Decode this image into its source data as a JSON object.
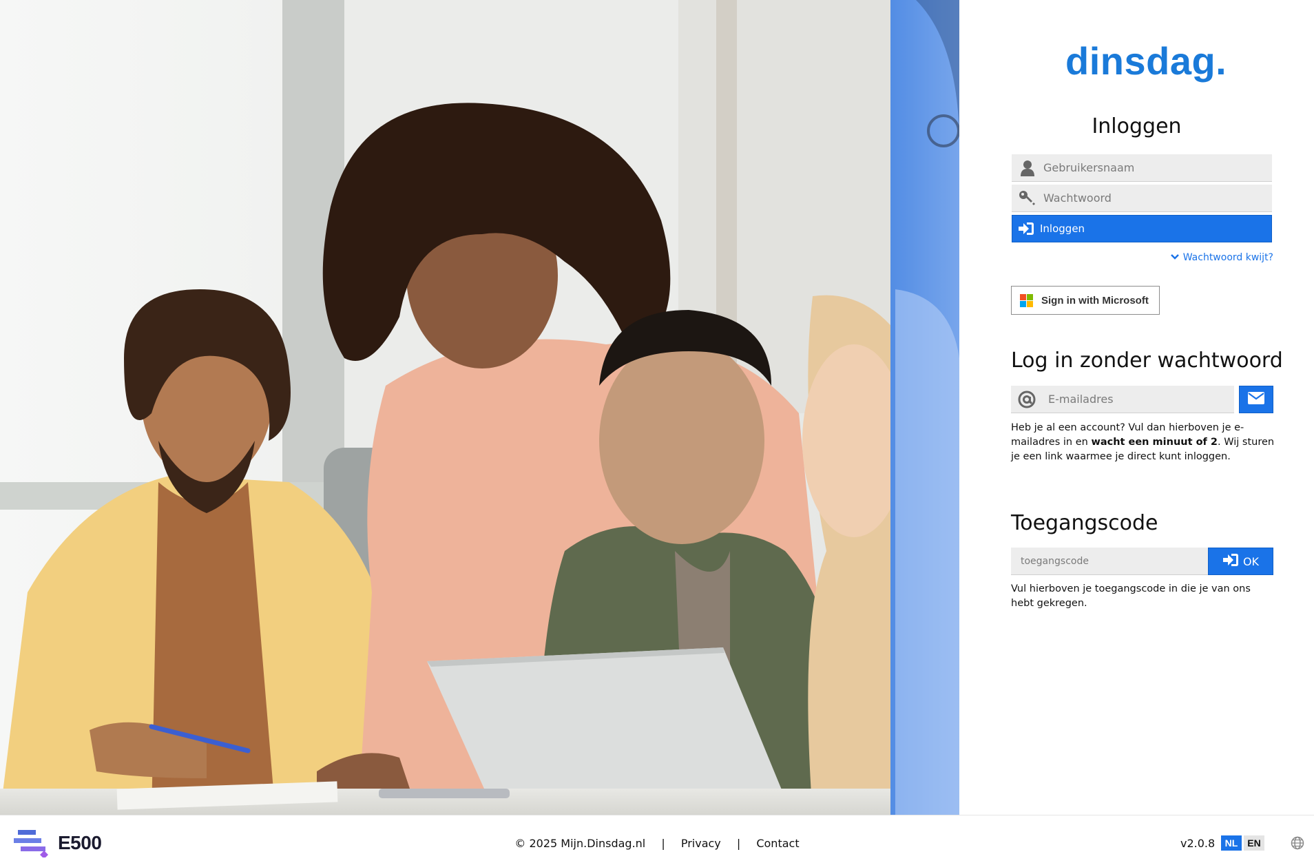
{
  "brand": {
    "logo_text": "dinsdag.",
    "accent_color": "#1a73e8"
  },
  "login": {
    "title": "Inloggen",
    "username_placeholder": "Gebruikersnaam",
    "password_placeholder": "Wachtwoord",
    "submit_label": "Inloggen",
    "forgot_label": "Wachtwoord kwijt?",
    "microsoft_label": "Sign in with Microsoft"
  },
  "passwordless": {
    "title": "Log in zonder wachtwoord",
    "email_placeholder": "E-mailadres",
    "help_before": "Heb je al een account? Vul dan hierboven je e-mailadres in en ",
    "help_bold": "wacht een minuut of 2",
    "help_after": ". Wij sturen je een link waarmee je direct kunt inloggen."
  },
  "access_code": {
    "title": "Toegangscode",
    "placeholder": "toegangscode",
    "ok_label": "OK",
    "help": "Vul hierboven je toegangscode in die je van ons hebt gekregen."
  },
  "footer": {
    "company_logo": "E500",
    "copyright": "© 2025 Mijn.Dinsdag.nl",
    "separator": "|",
    "privacy": "Privacy",
    "contact": "Contact",
    "version": "v2.0.8",
    "lang_nl": "NL",
    "lang_en": "EN"
  },
  "icons": {
    "user": "user-icon",
    "key": "key-icon",
    "sign_in": "sign-in-icon",
    "chevron": "chevron-down-icon",
    "at": "at-icon",
    "envelope": "envelope-icon",
    "globe": "globe-icon"
  }
}
